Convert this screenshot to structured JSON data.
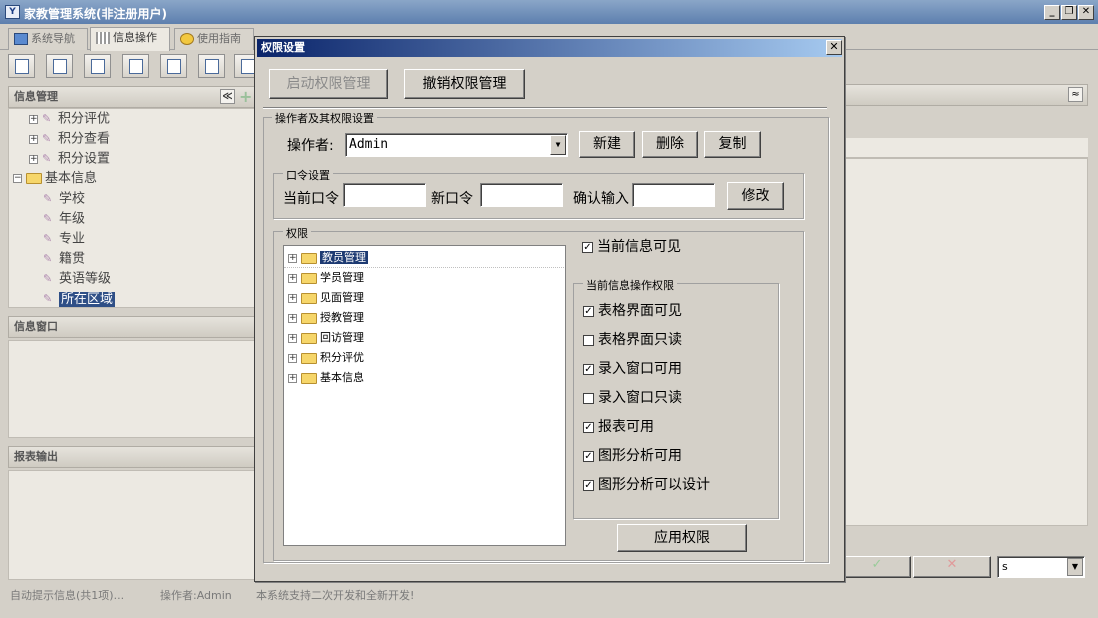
{
  "window": {
    "title": "家教管理系统(非注册用户)",
    "min": "_",
    "restore": "❐",
    "close": "✕"
  },
  "tabs": [
    {
      "label": "系统导航"
    },
    {
      "label": "信息操作"
    },
    {
      "label": "使用指南"
    }
  ],
  "left": {
    "info_header": "信息管理",
    "collapse_glyph": "≪",
    "tree": [
      {
        "label": "积分评优"
      },
      {
        "label": "积分查看"
      },
      {
        "label": "积分设置"
      },
      {
        "label": "基本信息"
      },
      {
        "label": "学校"
      },
      {
        "label": "年级"
      },
      {
        "label": "专业"
      },
      {
        "label": "籍贯"
      },
      {
        "label": "英语等级"
      },
      {
        "label": "所在区域"
      }
    ],
    "window_header": "信息窗口",
    "report_header": "报表输出"
  },
  "status": {
    "hint": "自动提示信息(共1项)...",
    "operator": "操作者:Admin",
    "note": "本系统支持二次开发和全新开发!"
  },
  "right": {
    "select_value": "s",
    "collapse_glyph": "≈"
  },
  "dialog": {
    "title": "权限设置",
    "close": "✕",
    "start_btn": "启动权限管理",
    "cancel_btn": "撤销权限管理",
    "op_group": "操作者及其权限设置",
    "operator_label": "操作者:",
    "operator_value": "Admin",
    "new_btn": "新建",
    "delete_btn": "删除",
    "copy_btn": "复制",
    "pwd_group": "口令设置",
    "current_pwd": "当前口令",
    "new_pwd": "新口令",
    "confirm_pwd": "确认输入",
    "modify_btn": "修改",
    "perm_group": "权限",
    "perm_tree": [
      {
        "label": "教员管理"
      },
      {
        "label": "学员管理"
      },
      {
        "label": "见面管理"
      },
      {
        "label": "授教管理"
      },
      {
        "label": "回访管理"
      },
      {
        "label": "积分评优"
      },
      {
        "label": "基本信息"
      }
    ],
    "visible_label": "当前信息可见",
    "ops_group": "当前信息操作权限",
    "ops": [
      {
        "label": "表格界面可见",
        "checked": true
      },
      {
        "label": "表格界面只读",
        "checked": false
      },
      {
        "label": "录入窗口可用",
        "checked": true
      },
      {
        "label": "录入窗口只读",
        "checked": false
      },
      {
        "label": "报表可用",
        "checked": true
      },
      {
        "label": "图形分析可用",
        "checked": true
      },
      {
        "label": "图形分析可以设计",
        "checked": true
      }
    ],
    "apply_btn": "应用权限"
  }
}
